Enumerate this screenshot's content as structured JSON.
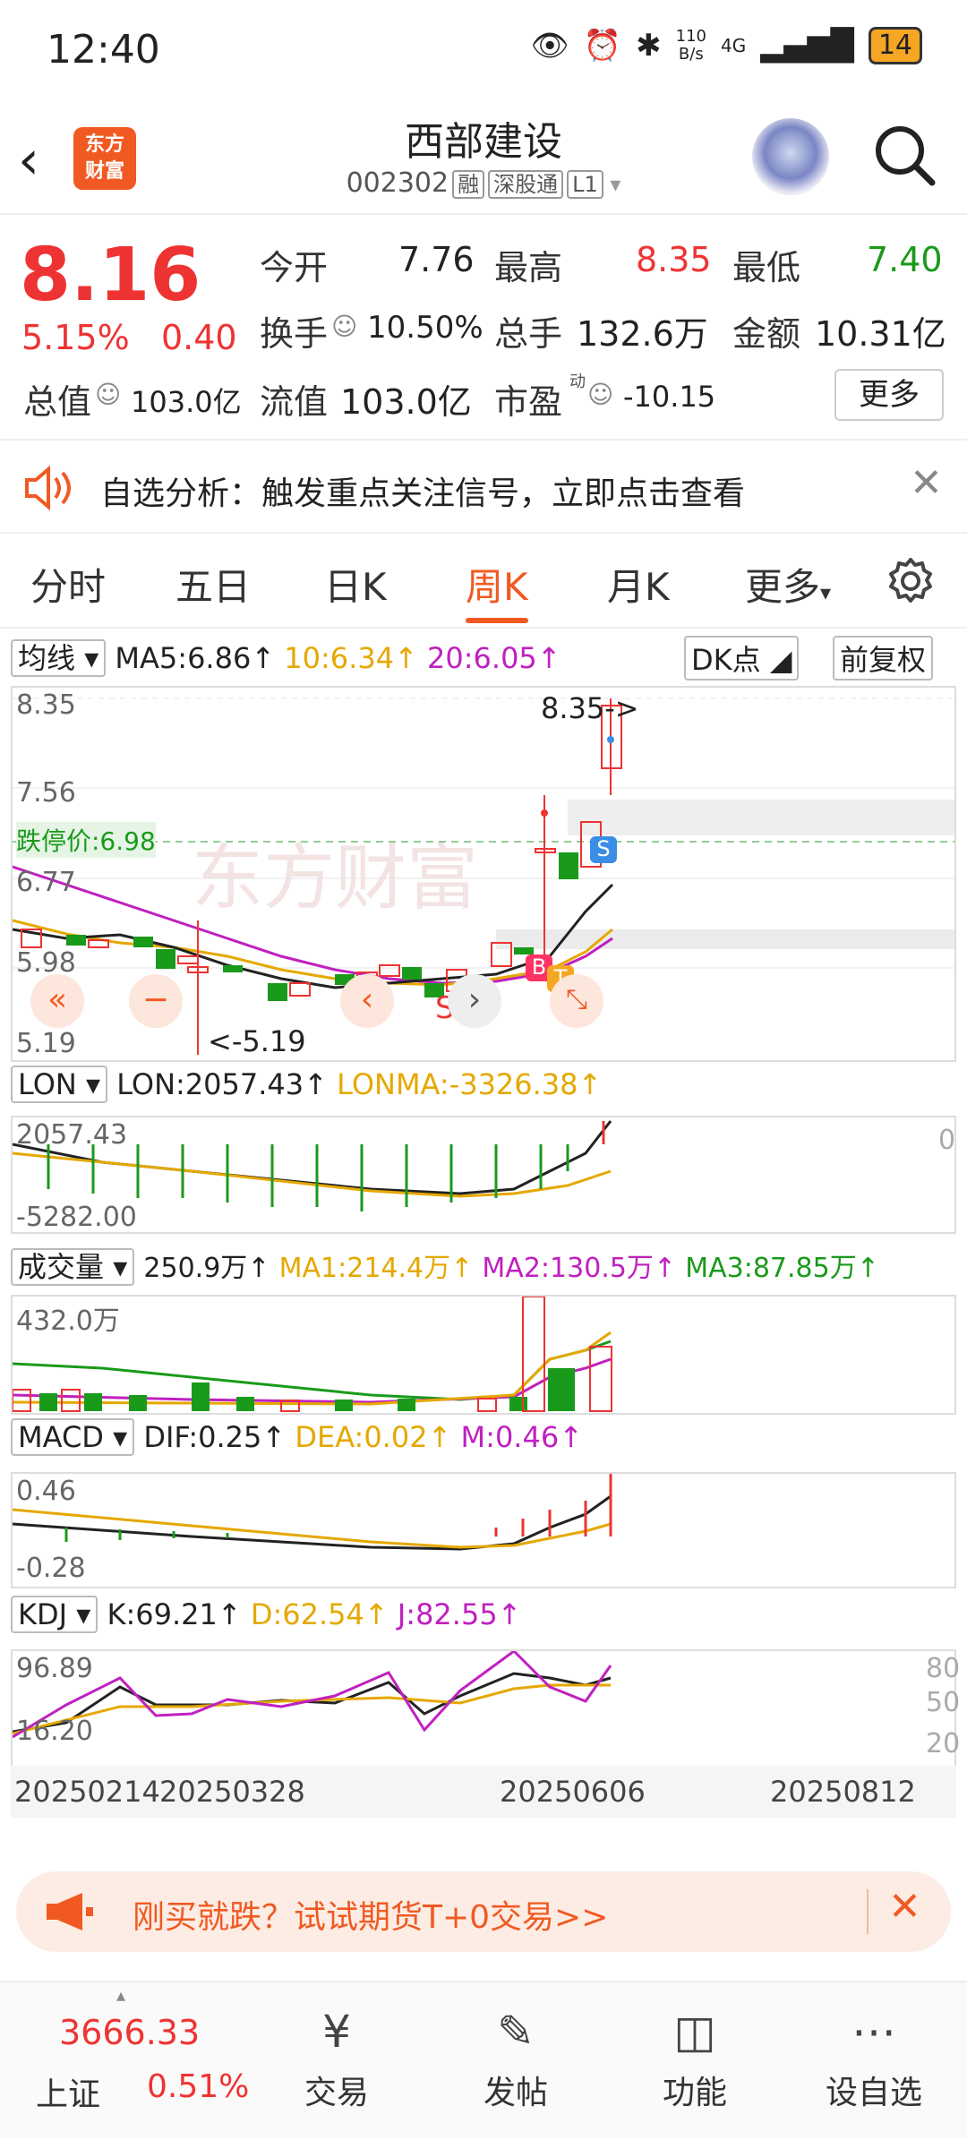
{
  "status": {
    "time": "12:40",
    "net_speed_top": "110",
    "net_speed_bottom": "B/s",
    "network": "4G",
    "battery": "14"
  },
  "header": {
    "title": "西部建设",
    "code": "002302",
    "tags": [
      "融",
      "深股通",
      "L1"
    ],
    "logo_line1": "东方",
    "logo_line2": "财富"
  },
  "quote": {
    "price": "8.16",
    "change_pct": "5.15%",
    "change_amt": "0.40",
    "open_label": "今开",
    "open": "7.76",
    "high_label": "最高",
    "high": "8.35",
    "low_label": "最低",
    "low": "7.40",
    "turnover_label": "换手",
    "turnover": "10.50%",
    "volume_label": "总手",
    "volume": "132.6万",
    "amount_label": "金额",
    "amount": "10.31亿",
    "mktcap_label": "总值",
    "mktcap": "103.0亿",
    "float_label": "流值",
    "float": "103.0亿",
    "pe_label": "市盈",
    "pe_sup": "动",
    "pe": "-10.15",
    "more": "更多"
  },
  "banner_top": {
    "text": "自选分析：触发重点关注信号，立即点击查看"
  },
  "tabs": [
    "分时",
    "五日",
    "日K",
    "周K",
    "月K",
    "更多"
  ],
  "active_tab": "周K",
  "kline": {
    "legend_select": "均线",
    "ma5": "MA5:6.86↑",
    "ma10": "10:6.34↑",
    "ma20": "20:6.05↑",
    "dk_label": "DK点",
    "fq_label": "前复权",
    "y_labels": [
      "8.35",
      "7.56",
      "6.77",
      "5.98",
      "5.19"
    ],
    "limit_label": "跌停价:6.98",
    "high_marker": "8.35->",
    "low_marker": "<-5.19",
    "markers": {
      "b": "B",
      "t": "T",
      "s": "S"
    },
    "watermark": "东方财富"
  },
  "lon": {
    "select": "LON",
    "lon": "LON:2057.43↑",
    "lonma": "LONMA:-3326.38↑",
    "y_top": "2057.43",
    "y_bottom": "-5282.00",
    "zero": "0"
  },
  "vol": {
    "select": "成交量",
    "value": "250.9万↑",
    "ma1": "MA1:214.4万↑",
    "ma2": "MA2:130.5万↑",
    "ma3": "MA3:87.85万↑",
    "y_top": "432.0万"
  },
  "macd": {
    "select": "MACD",
    "dif": "DIF:0.25↑",
    "dea": "DEA:0.02↑",
    "m": "M:0.46↑",
    "y_top": "0.46",
    "y_bottom": "-0.28"
  },
  "kdj": {
    "select": "KDJ",
    "k": "K:69.21↑",
    "d": "D:62.54↑",
    "j": "J:82.55↑",
    "y_top": "96.89",
    "y_bottom": "16.20",
    "r80": "80",
    "r50": "50",
    "r20": "20"
  },
  "x_dates": [
    "20250214",
    "20250328",
    "20250606",
    "20250812"
  ],
  "banner_bottom": {
    "text": "刚买就跌？试试期货T+0交易>>"
  },
  "bottom_nav": {
    "index_value": "3666.33",
    "index_name": "上证",
    "index_change": "0.51%",
    "items": [
      "交易",
      "发帖",
      "功能",
      "设自选"
    ]
  },
  "colors": {
    "up": "#e33333",
    "down": "#1a9a1a",
    "accent": "#f05a22",
    "ma10": "#e5a800",
    "ma20": "#c020c0"
  }
}
